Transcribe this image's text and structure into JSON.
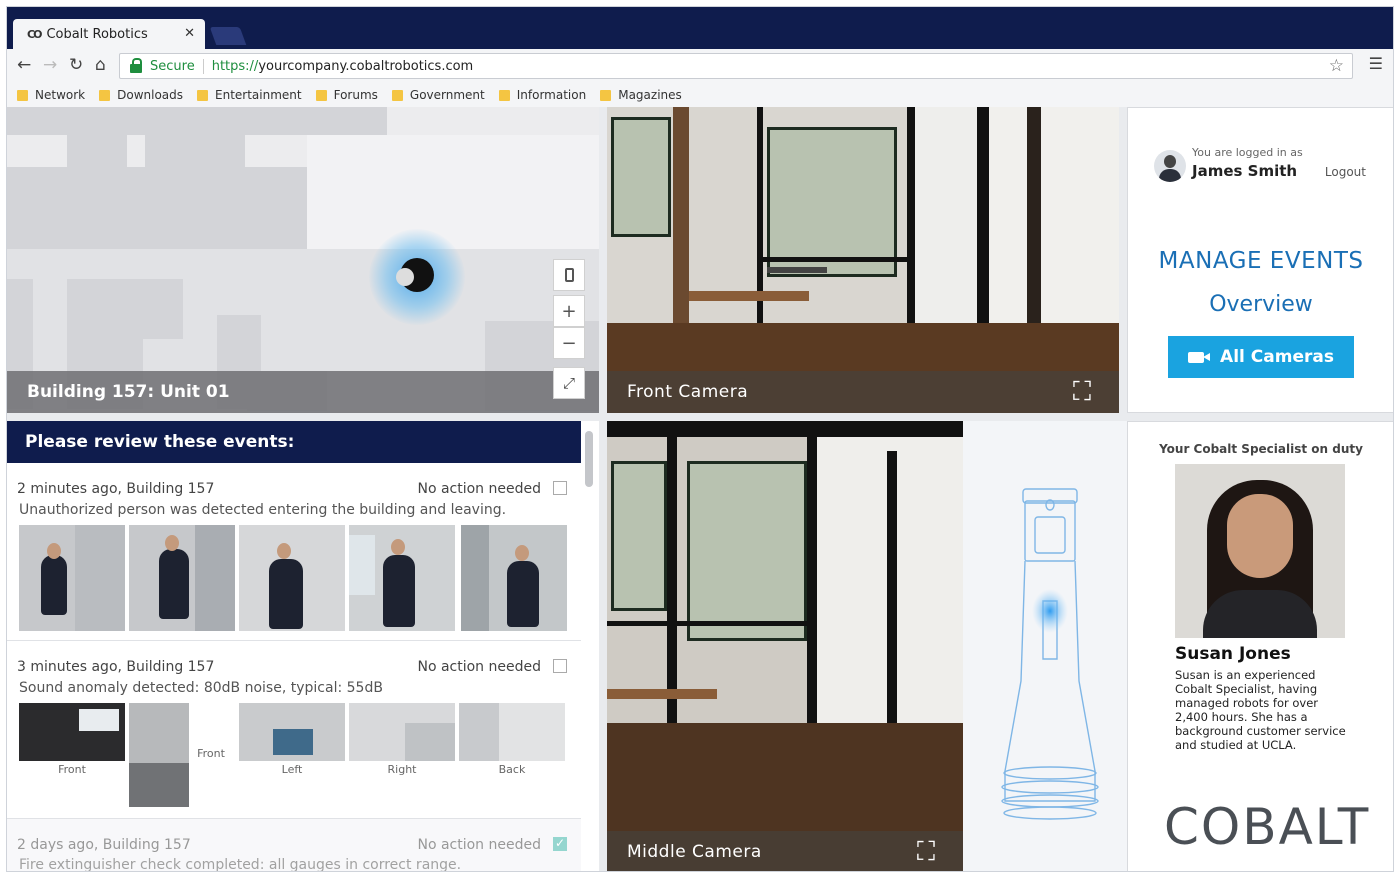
{
  "browser": {
    "tab_title": "Cobalt Robotics",
    "tab_favicon": "CO",
    "secure_label": "Secure",
    "url_protocol": "https://",
    "url_host": "yourcompany.cobaltrobotics.com",
    "bookmarks": [
      "Network",
      "Downloads",
      "Entertainment",
      "Forums",
      "Government",
      "Information",
      "Magazines"
    ]
  },
  "map": {
    "location_label": "Building 157: Unit 01"
  },
  "cameras": {
    "front_label": "Front Camera",
    "middle_label": "Middle Camera"
  },
  "user": {
    "logged_in_label": "You are logged in as",
    "name": "James Smith",
    "logout_label": "Logout"
  },
  "nav": {
    "manage_events": "MANAGE EVENTS",
    "overview": "Overview",
    "all_cameras": "All Cameras"
  },
  "events": {
    "header": "Please review these events:",
    "items": [
      {
        "time": "2 minutes ago, Building 157",
        "status": "No action needed",
        "description": "Unauthorized person was detected entering the building and leaving.",
        "checked": false
      },
      {
        "time": "3 minutes ago, Building 157",
        "status": "No action needed",
        "description": "Sound anomaly detected: 80dB noise, typical: 55dB",
        "checked": false,
        "thumb_labels": [
          "Front",
          "Front",
          "Left",
          "Right",
          "Back"
        ]
      },
      {
        "time": "2 days ago, Building 157",
        "status": "No action needed",
        "description": "Fire extinguisher check completed: all gauges in correct range.",
        "checked": true
      }
    ]
  },
  "specialist": {
    "title": "Your Cobalt Specialist on duty",
    "name": "Susan Jones",
    "bio": "Susan is an experienced Cobalt Specialist, having managed robots for over 2,400 hours. She has a background customer service and studied at UCLA."
  },
  "brand": {
    "logo_text": "COBALT"
  },
  "colors": {
    "navy": "#0f1c4d",
    "accent_blue": "#1a6fb5",
    "button_blue": "#1aa3e0",
    "check_teal": "#3fb6a8"
  }
}
